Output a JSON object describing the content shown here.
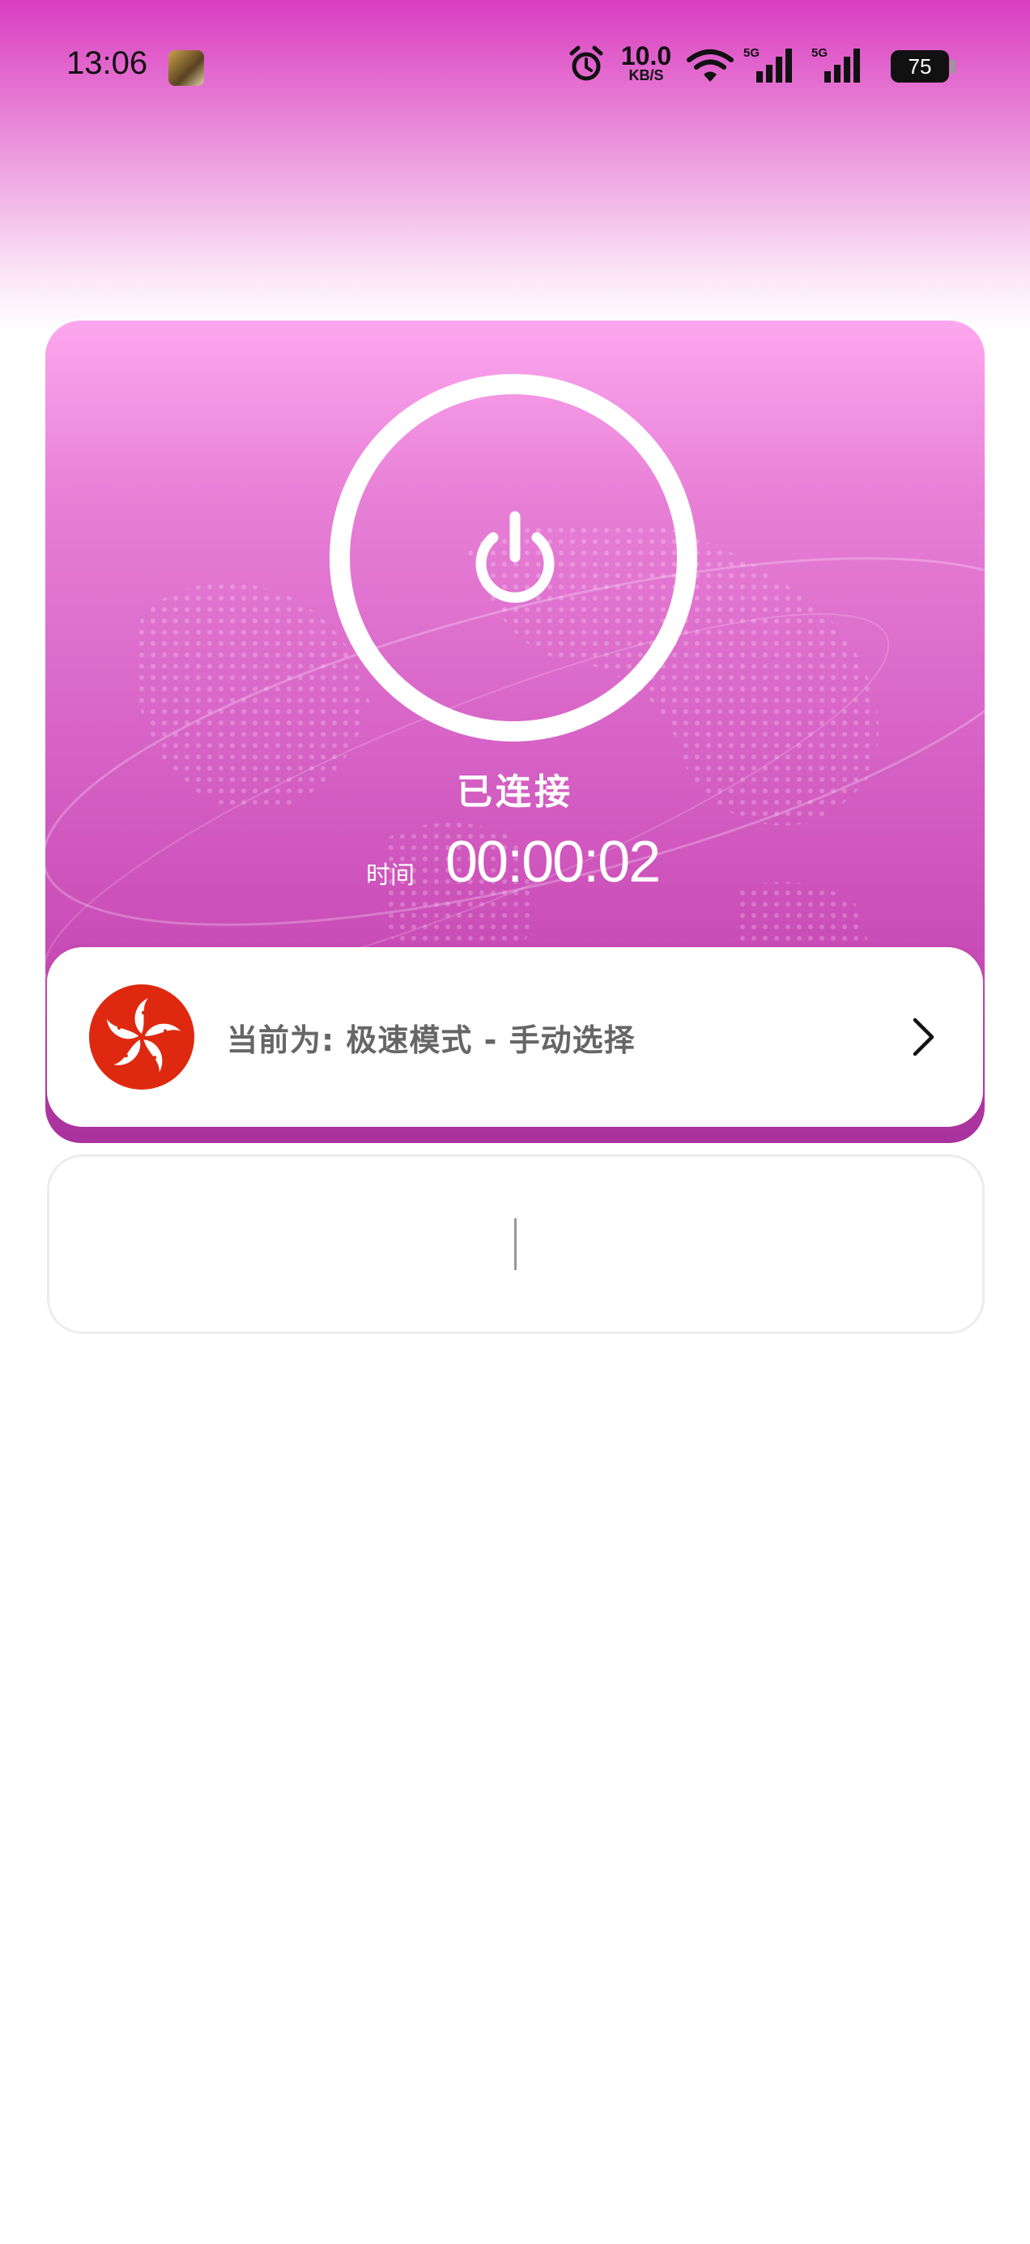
{
  "status_bar": {
    "time": "13:06",
    "net_speed_value": "10.0",
    "net_speed_unit": "KB/S",
    "signal_1_label": "5G",
    "signal_2_label": "5G",
    "battery": "75",
    "icons": [
      "app-thumbnail-icon",
      "alarm-icon",
      "wifi-icon",
      "signal-icon",
      "signal-icon",
      "battery-icon"
    ]
  },
  "connection": {
    "status": "已连接",
    "time_label": "时间",
    "elapsed": "00:00:02",
    "button_icon": "power-icon"
  },
  "mode": {
    "label": "当前为: 极速模式 - 手动选择",
    "flag_icon": "hong-kong-flag-icon",
    "chevron_icon": "chevron-right-icon"
  },
  "colors": {
    "accent_top": "#fca7ee",
    "accent_bottom": "#a8319e",
    "flag_red": "#de2910"
  }
}
